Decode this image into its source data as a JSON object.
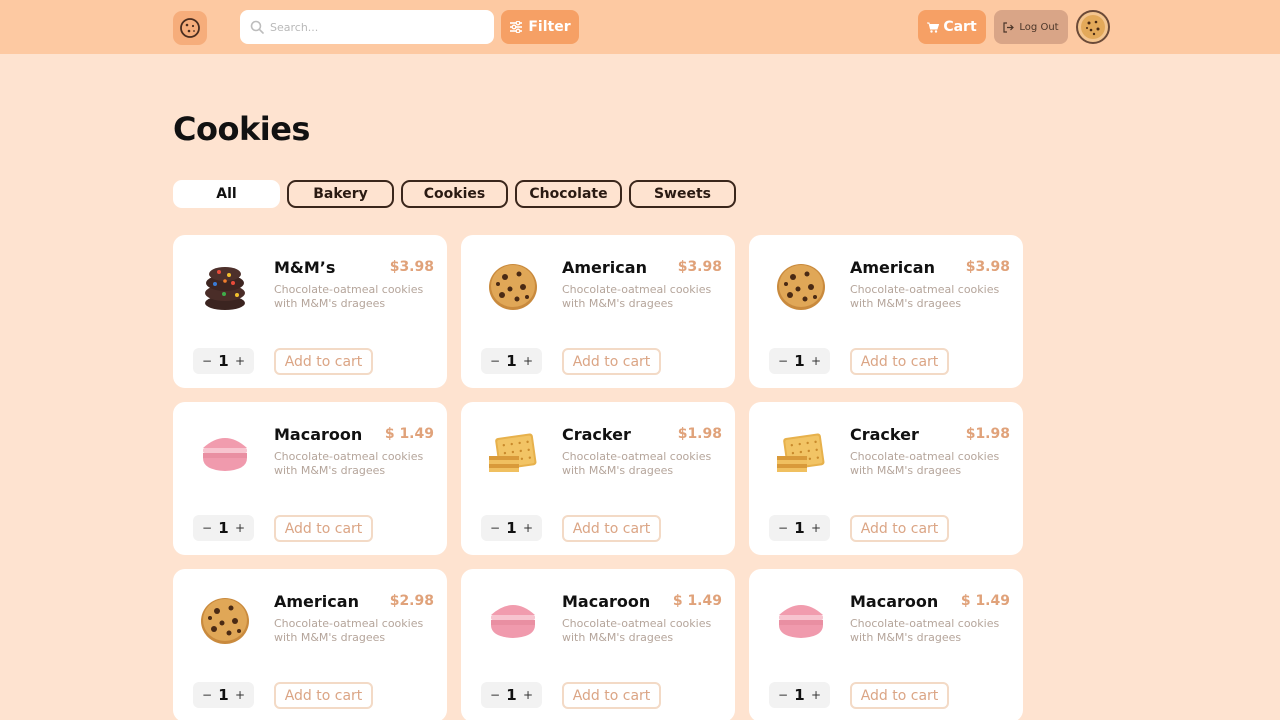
{
  "header": {
    "search_placeholder": "Search...",
    "filter_label": "Filter",
    "cart_label": "Cart",
    "logout_label": "Log Out"
  },
  "page": {
    "title": "Cookies"
  },
  "chips": [
    {
      "label": "All",
      "active": true
    },
    {
      "label": "Bakery",
      "active": false
    },
    {
      "label": "Cookies",
      "active": false
    },
    {
      "label": "Chocolate",
      "active": false
    },
    {
      "label": "Sweets",
      "active": false
    }
  ],
  "products": [
    {
      "name": "M&M’s",
      "price": "$3.98",
      "desc": "Chocolate-oatmeal cookies with M&M's dragees",
      "qty": "1",
      "image": "mm-cookie-icon",
      "add_label": "Add to cart"
    },
    {
      "name": "American",
      "price": "$3.98",
      "desc": "Chocolate-oatmeal cookies with M&M's dragees",
      "qty": "1",
      "image": "chocolate-chip-cookie-icon",
      "add_label": "Add to cart"
    },
    {
      "name": "American",
      "price": "$3.98",
      "desc": "Chocolate-oatmeal cookies with M&M's dragees",
      "qty": "1",
      "image": "chocolate-chip-cookie-icon",
      "add_label": "Add to cart"
    },
    {
      "name": "Macaroon",
      "price": "$ 1.49",
      "desc": "Chocolate-oatmeal cookies with M&M's dragees",
      "qty": "1",
      "image": "macaroon-icon",
      "add_label": "Add to cart"
    },
    {
      "name": "Cracker",
      "price": "$1.98",
      "desc": "Chocolate-oatmeal cookies with M&M's dragees",
      "qty": "1",
      "image": "cracker-icon",
      "add_label": "Add to cart"
    },
    {
      "name": "Cracker",
      "price": "$1.98",
      "desc": "Chocolate-oatmeal cookies with M&M's dragees",
      "qty": "1",
      "image": "cracker-icon",
      "add_label": "Add to cart"
    },
    {
      "name": "American",
      "price": "$2.98",
      "desc": "Chocolate-oatmeal cookies with M&M's dragees",
      "qty": "1",
      "image": "chocolate-chip-cookie-icon",
      "add_label": "Add to cart"
    },
    {
      "name": "Macaroon",
      "price": "$ 1.49",
      "desc": "Chocolate-oatmeal cookies with M&M's dragees",
      "qty": "1",
      "image": "macaroon-icon",
      "add_label": "Add to cart"
    },
    {
      "name": "Macaroon",
      "price": "$ 1.49",
      "desc": "Chocolate-oatmeal cookies with M&M's dragees",
      "qty": "1",
      "image": "macaroon-icon",
      "add_label": "Add to cart"
    }
  ],
  "colors": {
    "background": "#fee3d0",
    "topbar": "#fdc9a2",
    "accent": "#f6a065",
    "price": "#e0a27a",
    "logout": "#d9a587"
  }
}
